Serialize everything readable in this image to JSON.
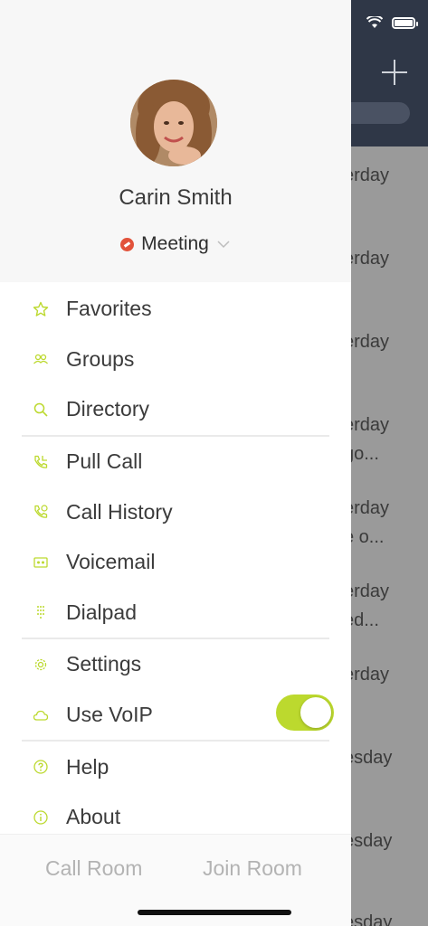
{
  "background": {
    "rows": [
      "erday",
      "erday",
      "erday",
      "erday",
      "go...",
      "erday",
      "e o...",
      "erday",
      "ed...",
      "erday",
      "esday",
      "esday",
      "esday"
    ]
  },
  "profile": {
    "name": "Carin Smith",
    "status": "Meeting",
    "status_color": "#e2523a"
  },
  "menu": {
    "items": [
      {
        "label": "Favorites",
        "icon": "star-icon"
      },
      {
        "label": "Groups",
        "icon": "groups-icon"
      },
      {
        "label": "Directory",
        "icon": "search-icon"
      },
      {
        "label": "Pull Call",
        "icon": "pull-call-icon"
      },
      {
        "label": "Call History",
        "icon": "call-history-icon"
      },
      {
        "label": "Voicemail",
        "icon": "voicemail-icon"
      },
      {
        "label": "Dialpad",
        "icon": "dialpad-icon"
      },
      {
        "label": "Settings",
        "icon": "gear-icon"
      },
      {
        "label": "Use VoIP",
        "icon": "cloud-icon"
      },
      {
        "label": "Help",
        "icon": "help-icon"
      },
      {
        "label": "About",
        "icon": "info-icon"
      }
    ],
    "voip_enabled": true
  },
  "bottom": {
    "call_room": "Call Room",
    "join_room": "Join Room"
  },
  "colors": {
    "accent": "#bcd92e",
    "header": "#2f3747"
  }
}
